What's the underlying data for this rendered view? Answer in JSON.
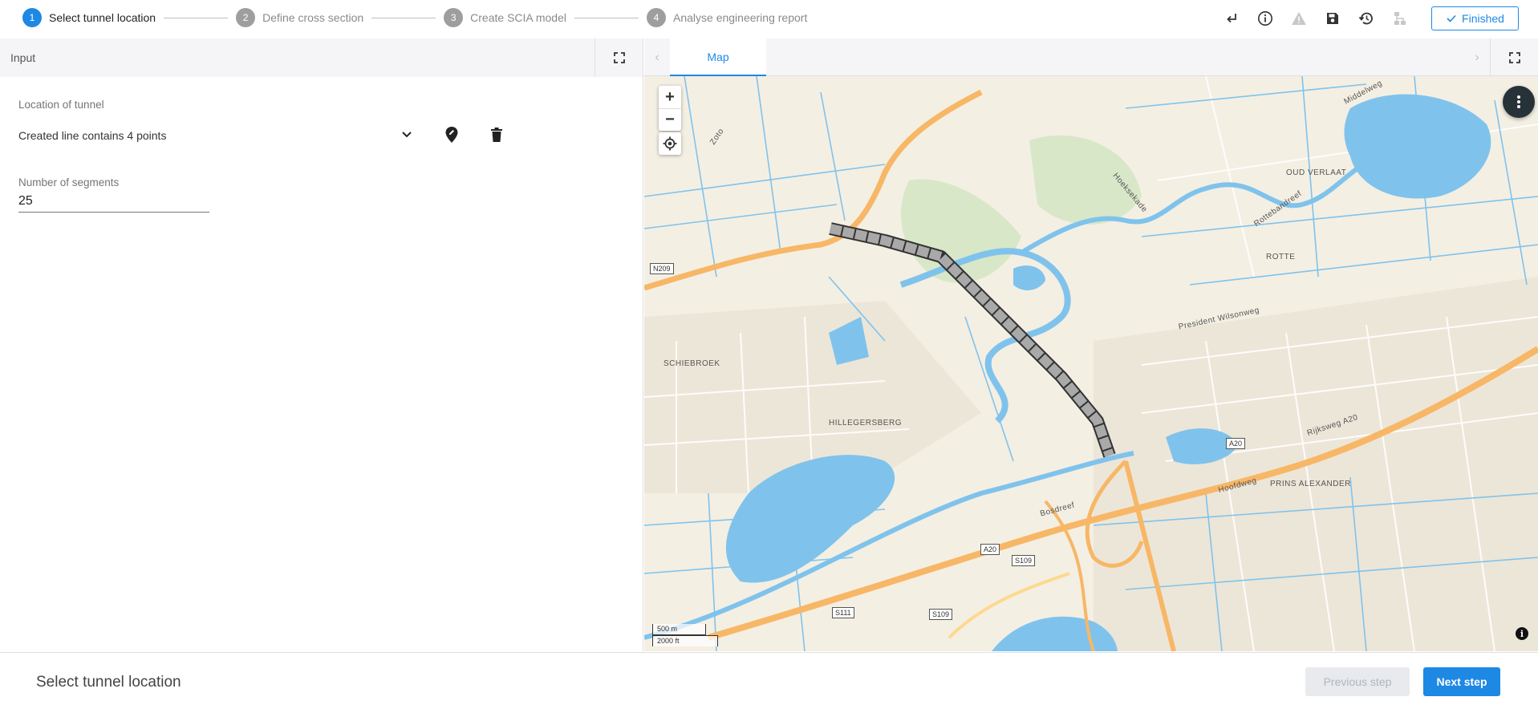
{
  "stepper": {
    "steps": [
      {
        "num": "1",
        "label": "Select tunnel location"
      },
      {
        "num": "2",
        "label": "Define cross section"
      },
      {
        "num": "3",
        "label": "Create SCIA model"
      },
      {
        "num": "4",
        "label": "Analyse engineering report"
      }
    ]
  },
  "toolbar": {
    "icons": [
      "return-icon",
      "info-icon",
      "warning-icon",
      "save-icon",
      "history-icon",
      "sitemap-icon"
    ],
    "finished_label": "Finished"
  },
  "input_panel": {
    "title": "Input",
    "location_label": "Location of tunnel",
    "location_value": "Created line contains 4 points",
    "segments_label": "Number of segments",
    "segments_value": "25"
  },
  "map_panel": {
    "tab_label": "Map",
    "place_labels": {
      "schiebroek": "SCHIEBROEK",
      "hillegersberg": "HILLEGERSBERG",
      "rotte": "ROTTE",
      "oud_verlaat": "OUD VERLAAT",
      "prins_alexander": "PRINS ALEXANDER",
      "president_wilsonweg": "President Wilsonweg",
      "rijksweg_a20": "Rijksweg A20",
      "hoofdweg": "Hoofdweg",
      "bosdreef": "Bosdreef",
      "rottebandreef": "Rottebandreef",
      "hoeksekade": "Hoeksekade",
      "middelweg": "Middelweg",
      "zoto": "Zoto"
    },
    "shields": {
      "n209": "N209",
      "a20_right": "A20",
      "a20_mid": "A20",
      "s109": "S109",
      "s111": "S111",
      "s109_b": "S109"
    },
    "scale_metric": "500 m",
    "scale_imperial": "2000 ft",
    "colors": {
      "water": "#7fc3ec",
      "land": "#f4efe3",
      "highway": "#f7b766",
      "tunnel": "#9e9e9e"
    }
  },
  "footer": {
    "title": "Select tunnel location",
    "prev_label": "Previous step",
    "next_label": "Next step"
  }
}
